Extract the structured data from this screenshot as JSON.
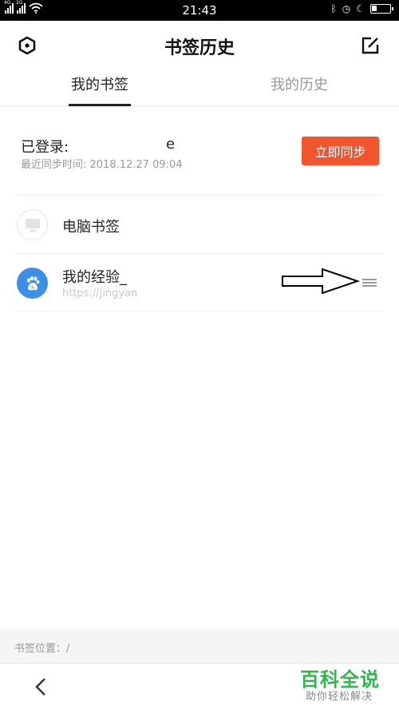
{
  "status_bar": {
    "time": "21:43",
    "sim1_label": "4G",
    "sim2_label": "2G",
    "icons": [
      "bluetooth-icon",
      "alarm-icon",
      "moon-icon",
      "battery-icon"
    ]
  },
  "header": {
    "title": "书签历史",
    "left_icon": "settings-hex-icon",
    "right_icon": "edit-icon"
  },
  "tabs": [
    {
      "label": "我的书签",
      "active": true
    },
    {
      "label": "我的历史",
      "active": false
    }
  ],
  "account": {
    "login_label": "已登录:",
    "username_visible": "e",
    "sync_time": "最近同步时间: 2018.12.27 09:04",
    "sync_button": "立即同步"
  },
  "bookmarks": [
    {
      "title": "电脑书签",
      "icon": "computer-icon"
    },
    {
      "title": "我的经验_",
      "url": "https://jingyan",
      "icon": "baidu-paw-icon"
    }
  ],
  "footer": {
    "path_label": "书签位置：/"
  },
  "watermark": {
    "title": "百科全说",
    "subtitle": "助你轻松解决"
  },
  "colors": {
    "accent": "#f2542d",
    "baidu_blue": "#3b8fe8",
    "watermark_green": "#2eb84a"
  }
}
